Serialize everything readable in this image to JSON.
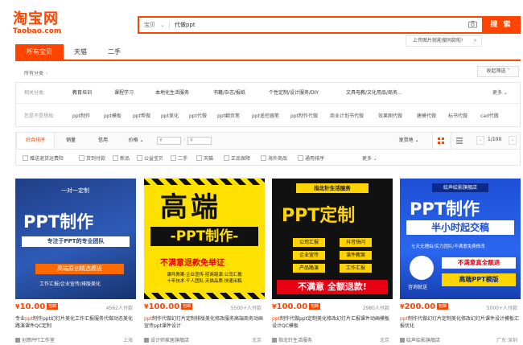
{
  "logo": {
    "main": "淘宝网",
    "sub": "Taobao.com"
  },
  "search": {
    "type_label": "宝贝",
    "value": "代做ppt",
    "button": "搜 索",
    "image_tip": "上传图片就能搜同款啦!"
  },
  "main_tabs": [
    {
      "label": "所有宝贝"
    },
    {
      "label": "天猫"
    },
    {
      "label": "二手"
    }
  ],
  "breadcrumb": {
    "label": "所有分类"
  },
  "collapse_label": "收起筛选",
  "categories": {
    "label": "相关分类:",
    "items": [
      "教育培训",
      "课程学习",
      "本地化生活服务",
      "书籍/杂志/报纸",
      "个性定制/设计服务/DIY",
      "文具电教/文化用品/商务..."
    ],
    "more": "更多"
  },
  "keywords": {
    "label": "您是不是想找:",
    "items": [
      "ppt制作",
      "ppt模板",
      "ppt帮做",
      "ppt美化",
      "ppt代做",
      "ppt翻页笔",
      "ppt遥控器笔",
      "ppt制作代做",
      "商业计划书代做",
      "效果图代做",
      "建模代做",
      "标书代做",
      "cad代做"
    ]
  },
  "sort": {
    "items": [
      "综合排序",
      "销量",
      "信用",
      "价格"
    ],
    "price_from": "¥",
    "price_to": "¥",
    "ship_from": "发货地",
    "page": "1/100"
  },
  "filters": {
    "items": [
      "赠送退货运费险",
      "货到付款",
      "新品",
      "公益宝贝",
      "二手",
      "天猫",
      "正品保障",
      "海外商品",
      "通用排序"
    ],
    "more": "更多"
  },
  "products": [
    {
      "img_top": "一对一定制",
      "img_main": "PPT制作",
      "img_sub": "专注于PPT的专业团队",
      "img_banner": "高端原创精选模板",
      "img_foot": "工作汇报/企业宣传/排版美化",
      "price": "10.00",
      "tag": "包邮",
      "sales": "4562人付款",
      "title_pre": "专业",
      "title_hl": "ppt",
      "title_post": "制作ppt幻灯片美化工作汇报服务代做动态美化路演课件QC定制",
      "shop": "创意PPT工作室",
      "location": "上海"
    },
    {
      "img_top": "高端",
      "img_main": "-PPT制作-",
      "img_sub": "不满意退款免举证",
      "img_foot": "课件教案·企业宣传·招商路演·公司汇报",
      "img_foot2": "十年技术·千人团队·天猫品质·快速出稿",
      "price": "100.00",
      "tag": "包邮",
      "sales": "5500+人付款",
      "title_pre": "",
      "title_hl": "ppt",
      "title_post": "制作代做幻灯片定制排版美化修改服务高端商务动画宣传ppt课件设计",
      "shop": "设计师家居旗舰店",
      "location": "北京"
    },
    {
      "img_top": "指北针生活服务",
      "img_main": "PPT定制",
      "img_chips": [
        "公司汇报",
        "抖音快闪",
        "企业宣传",
        "课件教案",
        "产品路演",
        "工作汇报"
      ],
      "img_banner": "不满意 全额退款!",
      "price": "100.00",
      "tag": "包邮",
      "sales": "2980人付款",
      "title_pre": "",
      "title_hl": "ppt",
      "title_post": "制作代做ppt定制美化修改幻灯片汇报课件动画模板设计QC模板",
      "shop": "指北针生活服务",
      "location": "北京"
    },
    {
      "img_top": "绘声绘影旗舰店",
      "img_main": "PPT制作",
      "img_sub": "半小时起交稿",
      "img_strip": "七天无理由/实力团队/不满意免费修改",
      "img_badge": "不满意真全额退",
      "img_foot": "高端PPT模版",
      "img_consult": "咨询就送",
      "price": "200.00",
      "tag": "包邮",
      "sales": "5000+人付款",
      "title_pre": "",
      "title_hl": "ppt",
      "title_post": "制作代做幻灯片定制美化修改幻灯片课件设计模板汇报优化",
      "shop": "绘声绘影旗舰店",
      "location": "广东 深圳"
    }
  ]
}
